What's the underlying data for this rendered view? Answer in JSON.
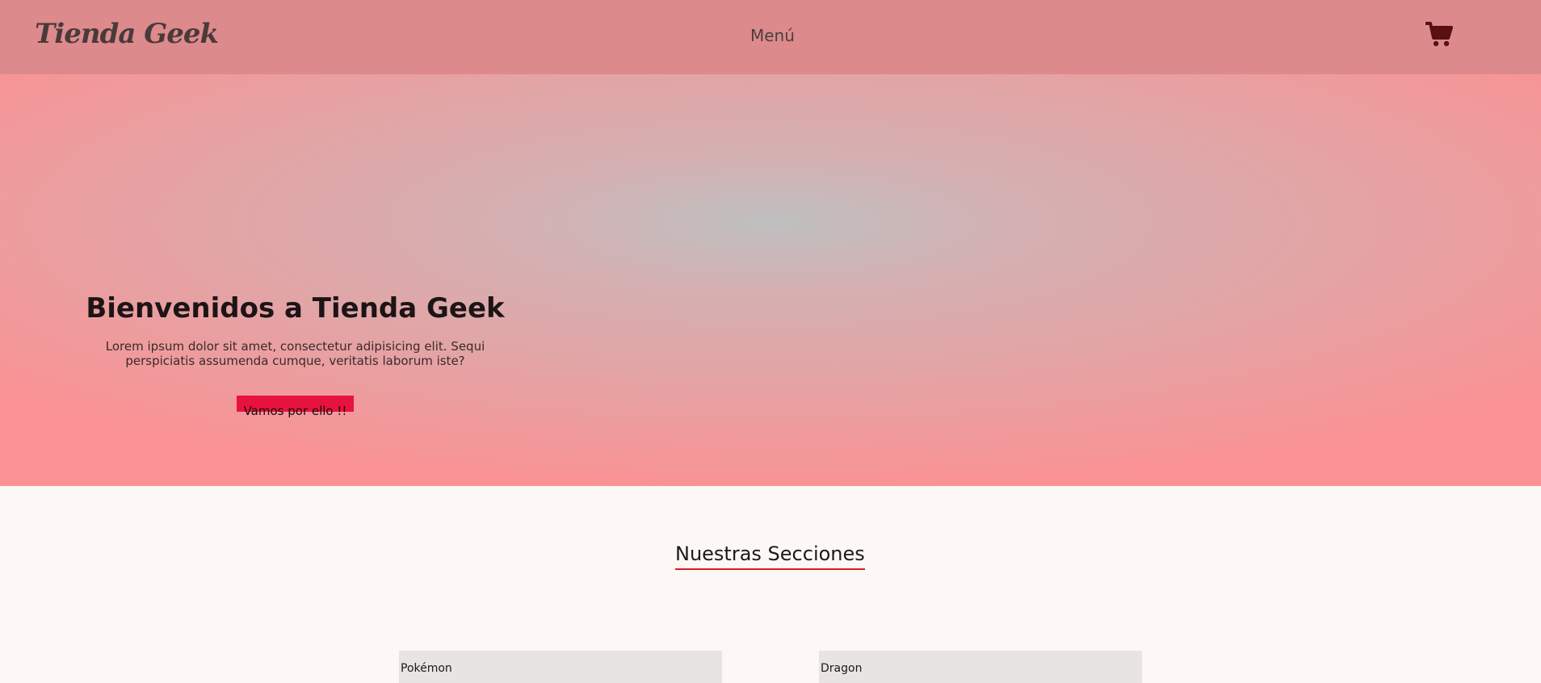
{
  "header": {
    "logo": "Tienda Geek",
    "menu_label": "Menú",
    "cart_icon": "shopping-cart-icon",
    "background": "#dd8a8c"
  },
  "hero": {
    "title": "Bienvenidos a Tienda Geek",
    "text": "Lorem ipsum dolor sit amet, consectetur adipisicing elit. Sequi perspiciatis assumenda cumque, veritatis laborum iste?",
    "cta_label": "Vamos por ello !!",
    "cta_color": "#e8123e"
  },
  "sections": {
    "title": "Nuestras Secciones",
    "underline_color": "#d81a22",
    "cards": [
      {
        "label": "Pokémon"
      },
      {
        "label": "Dragon"
      }
    ]
  }
}
